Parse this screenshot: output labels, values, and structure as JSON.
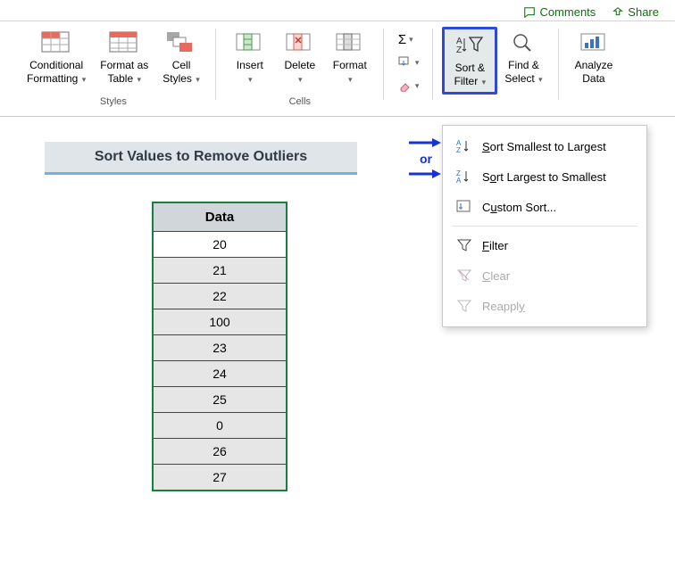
{
  "topbar": {
    "comments": "Comments",
    "share": "Share"
  },
  "ribbon": {
    "styles": {
      "label": "Styles",
      "cond_fmt_l1": "Conditional",
      "cond_fmt_l2": "Formatting",
      "fmt_table_l1": "Format as",
      "fmt_table_l2": "Table",
      "cell_styles_l1": "Cell",
      "cell_styles_l2": "Styles"
    },
    "cells": {
      "label": "Cells",
      "insert": "Insert",
      "delete": "Delete",
      "format": "Format"
    },
    "editing": {
      "sort_filter_l1": "Sort &",
      "sort_filter_l2": "Filter",
      "find_select_l1": "Find &",
      "find_select_l2": "Select"
    },
    "analyze": {
      "analyze_l1": "Analyze",
      "analyze_l2": "Data"
    }
  },
  "dropdown": {
    "sort_asc": "Sort Smallest to Largest",
    "sort_desc": "Sort Largest to Smallest",
    "custom": "Custom Sort...",
    "filter": "Filter",
    "clear": "Clear",
    "reapply": "Reapply"
  },
  "annot": {
    "or": "or"
  },
  "sheet_title": "Sort Values to Remove Outliers",
  "data": {
    "header": "Data",
    "rows": [
      "20",
      "21",
      "22",
      "100",
      "23",
      "24",
      "25",
      "0",
      "26",
      "27"
    ]
  }
}
